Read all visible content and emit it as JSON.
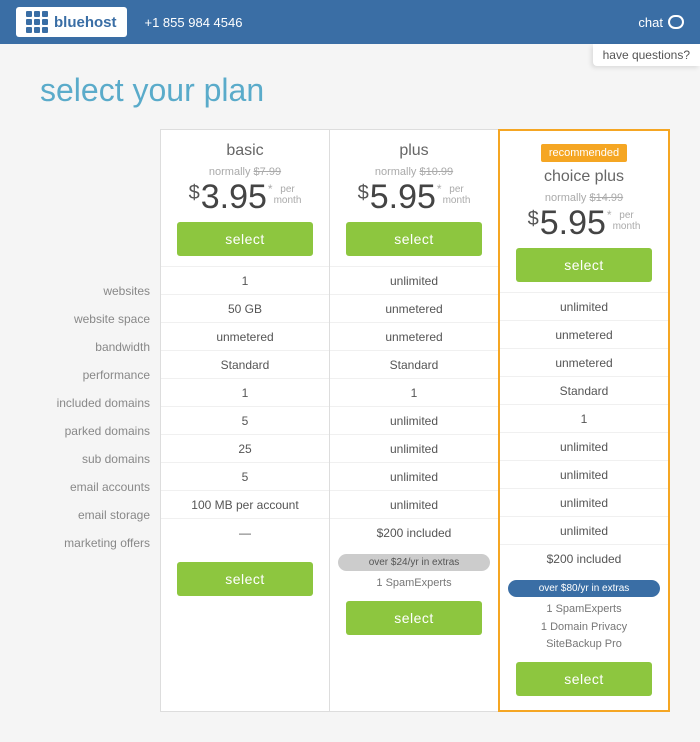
{
  "header": {
    "logo_text": "bluehost",
    "phone": "+1 855 984 4546",
    "chat_label": "chat",
    "have_questions": "have questions?"
  },
  "page": {
    "title": "select your plan"
  },
  "feature_labels": [
    "websites",
    "website space",
    "bandwidth",
    "performance",
    "included domains",
    "parked domains",
    "sub domains",
    "email accounts",
    "email storage",
    "marketing offers"
  ],
  "plans": [
    {
      "id": "basic",
      "name": "basic",
      "recommended": false,
      "recommended_label": "",
      "normally_label": "normally",
      "normally_price": "$7.99",
      "price_dollar": "$",
      "price_amount": "3.95",
      "price_asterisk": "*",
      "price_per": "per\nmonth",
      "select_label": "select",
      "features": [
        "1",
        "50 GB",
        "unmetered",
        "Standard",
        "1",
        "5",
        "25",
        "5",
        "100 MB per account",
        "—"
      ],
      "extras_badge": "",
      "extras_badge_style": "",
      "extra_items": [],
      "show_footer_select": true
    },
    {
      "id": "plus",
      "name": "plus",
      "recommended": false,
      "recommended_label": "",
      "normally_label": "normally",
      "normally_price": "$10.99",
      "price_dollar": "$",
      "price_amount": "5.95",
      "price_asterisk": "*",
      "price_per": "per\nmonth",
      "select_label": "select",
      "features": [
        "unlimited",
        "unmetered",
        "unmetered",
        "Standard",
        "1",
        "unlimited",
        "unlimited",
        "unlimited",
        "unlimited",
        "$200 included"
      ],
      "extras_badge": "over $24/yr in extras",
      "extras_badge_style": "gray",
      "extra_items": [
        "1 SpamExperts"
      ],
      "show_footer_select": true
    },
    {
      "id": "choice-plus",
      "name": "choice plus",
      "recommended": true,
      "recommended_label": "recommended",
      "normally_label": "normally",
      "normally_price": "$14.99",
      "price_dollar": "$",
      "price_amount": "5.95",
      "price_asterisk": "*",
      "price_per": "per\nmonth",
      "select_label": "select",
      "features": [
        "unlimited",
        "unmetered",
        "unmetered",
        "Standard",
        "1",
        "unlimited",
        "unlimited",
        "unlimited",
        "unlimited",
        "$200 included"
      ],
      "extras_badge": "over $80/yr in extras",
      "extras_badge_style": "blue",
      "extra_items": [
        "1 SpamExperts",
        "1 Domain Privacy",
        "SiteBackup Pro"
      ],
      "show_footer_select": true
    }
  ]
}
